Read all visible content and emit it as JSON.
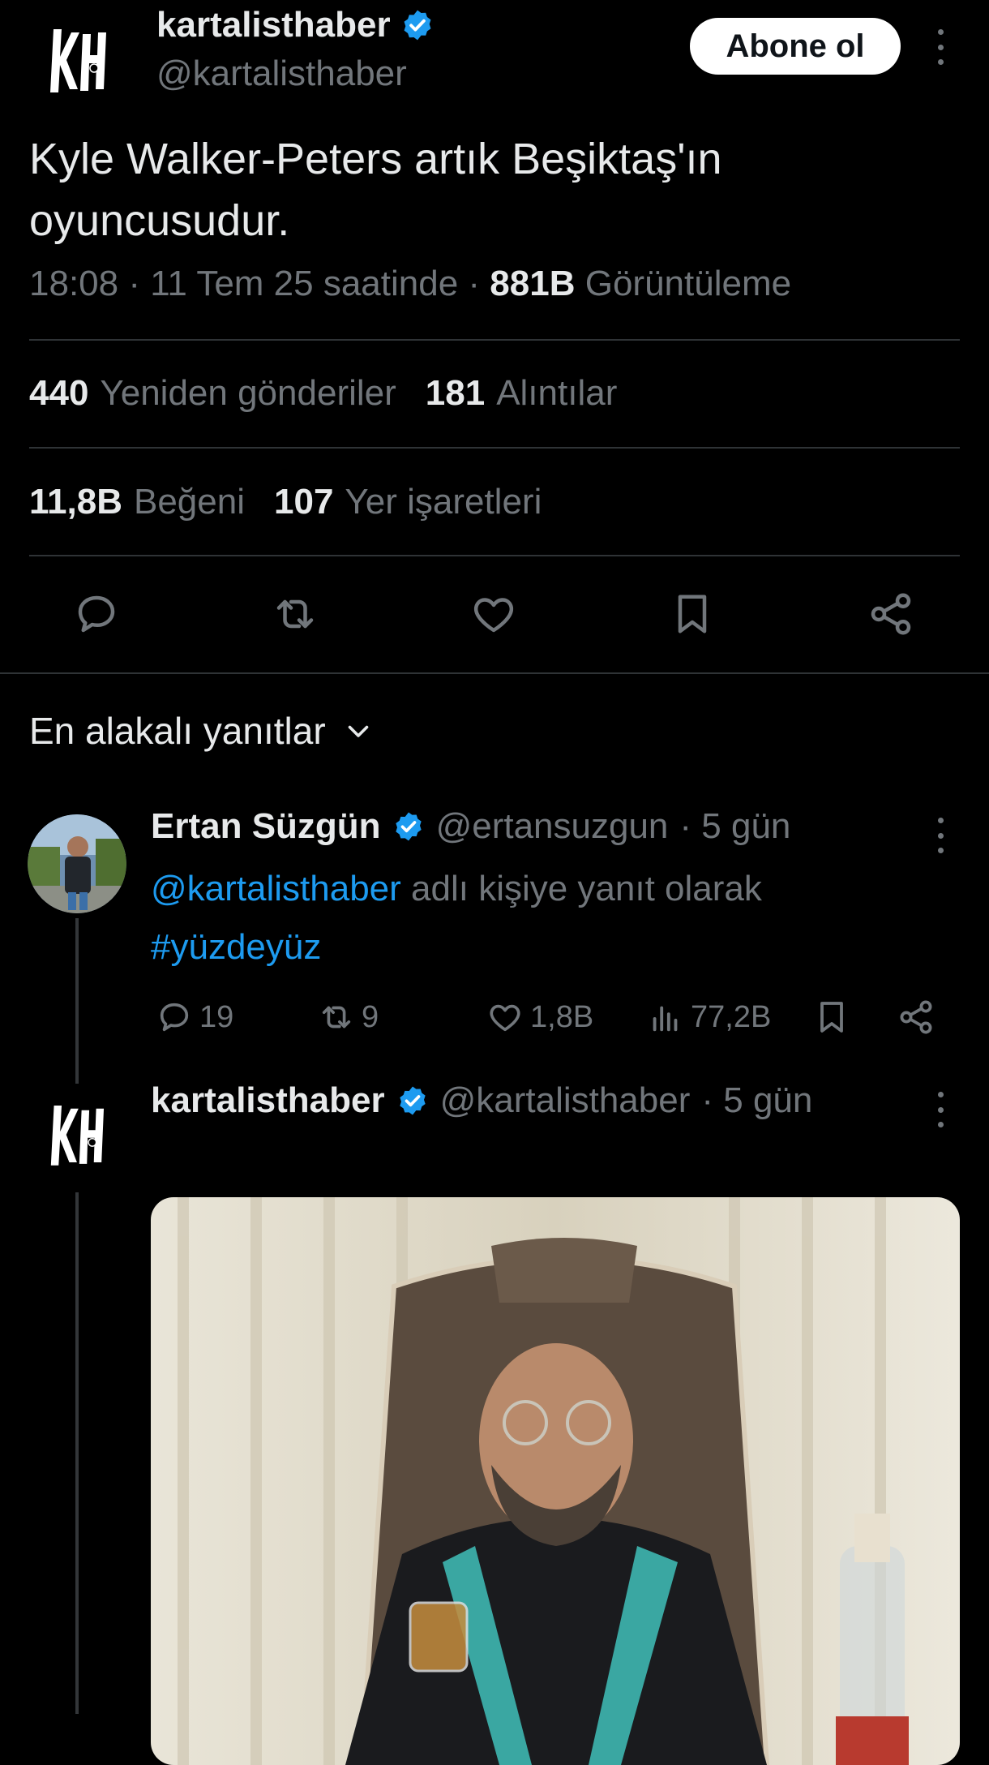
{
  "tweet": {
    "author_name": "kartalisthaber",
    "author_handle": "@kartalisthaber",
    "follow_label": "Abone ol",
    "text": "Kyle Walker-Peters artık Beşiktaş'ın oyuncusudur.",
    "time": "18:08 · 11 Tem 25 saatinde · ",
    "views_count": "881B",
    "views_label": "Görüntüleme",
    "reposts_count": "440",
    "reposts_label": "Yeniden gönderiler",
    "quotes_count": "181",
    "quotes_label": "Alıntılar",
    "likes_count": "11,8B",
    "likes_label": "Beğeni",
    "bookmarks_count": "107",
    "bookmarks_label": "Yer işaretleri"
  },
  "replies_sort_label": "En alakalı yanıtlar",
  "reply1": {
    "name": "Ertan Süzgün",
    "handle": "@ertansuzgun",
    "time": "· 5 gün",
    "mention": "@kartalisthaber",
    "reply_to_text": " adlı kişiye yanıt olarak",
    "hashtag": "#yüzdeyüz",
    "replies": "19",
    "reposts": "9",
    "likes": "1,8B",
    "views": "77,2B"
  },
  "reply2": {
    "name": "kartalisthaber",
    "handle": "@kartalisthaber",
    "time": "· 5 gün"
  },
  "colors": {
    "background": "#000000",
    "text": "#e7e9ea",
    "muted": "#71767b",
    "link": "#1d9bf0",
    "divider": "#2f3336"
  },
  "icons": [
    "kh-logo",
    "verified-badge-icon",
    "more-icon",
    "reply-icon",
    "repost-icon",
    "like-icon",
    "bookmark-icon",
    "share-icon",
    "chevron-down-icon",
    "views-icon"
  ]
}
